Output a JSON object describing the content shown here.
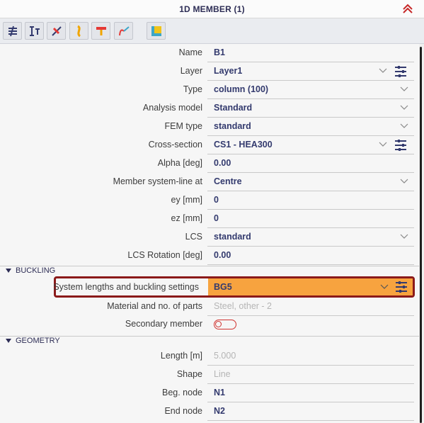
{
  "header": {
    "title": "1D MEMBER (1)"
  },
  "toolbar": {
    "buttons": [
      "member-properties",
      "ibeam-section",
      "hinge",
      "curve",
      "load",
      "split",
      "lshape"
    ]
  },
  "colors": {
    "accent": "#f7a33f",
    "highlight_border": "#8b1a1a",
    "value_text": "#333a6e"
  },
  "properties": [
    {
      "label": "Name",
      "value": "B1"
    },
    {
      "label": "Layer",
      "value": "Layer1"
    },
    {
      "label": "Type",
      "value": "column (100)"
    },
    {
      "label": "Analysis model",
      "value": "Standard"
    },
    {
      "label": "FEM type",
      "value": "standard"
    },
    {
      "label": "Cross-section",
      "value": "CS1 - HEA300"
    },
    {
      "label": "Alpha [deg]",
      "value": "0.00"
    },
    {
      "label": "Member system-line at",
      "value": "Centre"
    },
    {
      "label": "ey [mm]",
      "value": "0"
    },
    {
      "label": "ez [mm]",
      "value": "0"
    },
    {
      "label": "LCS",
      "value": "standard"
    },
    {
      "label": "LCS Rotation [deg]",
      "value": "0.00"
    }
  ],
  "buckling": {
    "title": "BUCKLING",
    "rows": [
      {
        "label": "System lengths and buckling settings",
        "value": "BG5"
      },
      {
        "label": "Material and no. of parts",
        "value": "Steel, other - 2"
      },
      {
        "label": "Secondary member",
        "value": "off"
      }
    ]
  },
  "geometry": {
    "title": "GEOMETRY",
    "rows": [
      {
        "label": "Length [m]",
        "value": "5.000"
      },
      {
        "label": "Shape",
        "value": "Line"
      },
      {
        "label": "Beg. node",
        "value": "N1"
      },
      {
        "label": "End node",
        "value": "N2"
      }
    ]
  }
}
